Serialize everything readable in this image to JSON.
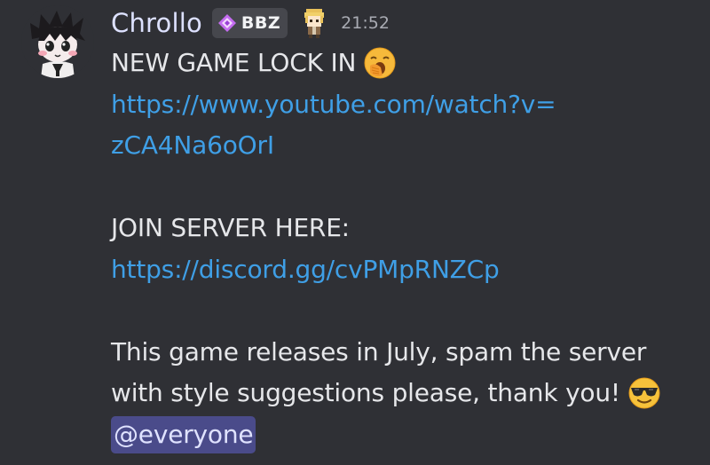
{
  "author": {
    "username": "Chrollo",
    "tag_label": "BBZ",
    "tag_icon": "diamond-badge-icon",
    "role_icon": "pixel-character-icon",
    "timestamp": "21:52",
    "avatar": "anime-avatar"
  },
  "message": {
    "line1": "NEW GAME LOCK IN",
    "line1_emoji": "yawning-face-emoji",
    "link1_part1": "https://www.youtube.com/watch?v=",
    "link1_part2": "zCA4Na6oOrI",
    "join_text": "JOIN SERVER HERE:",
    "link2": "https://discord.gg/cvPMpRNZCp",
    "para_line1": "This game releases in July, spam the server",
    "para_line2": "with style suggestions please, thank you!",
    "para_emoji": "sunglasses-face-emoji",
    "mention": "@everyone"
  },
  "colors": {
    "background": "#2f3035",
    "username": "#dde1ff",
    "link": "#3f9fe6",
    "mention_bg": "#4a4b8a",
    "text": "#e6e7ea",
    "timestamp": "#a9abb3"
  }
}
